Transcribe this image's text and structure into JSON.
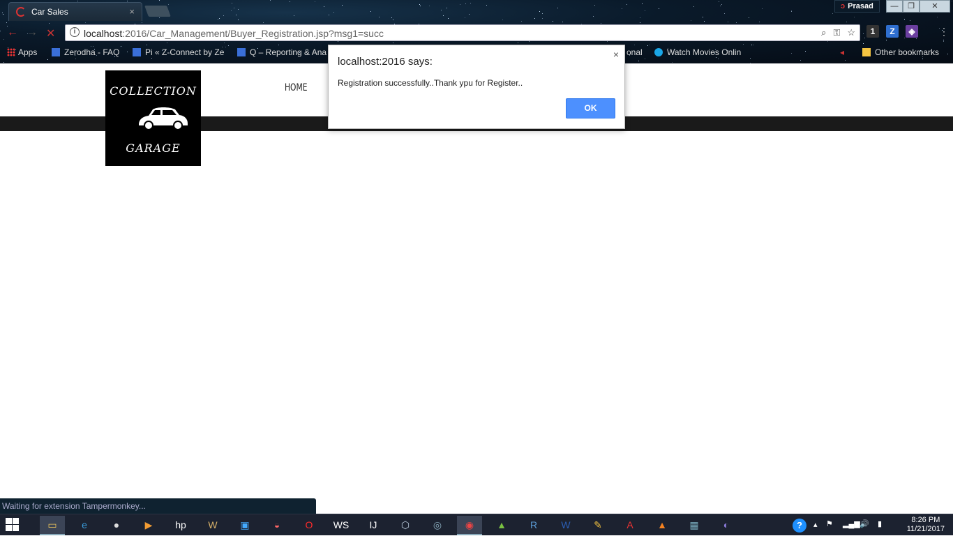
{
  "browser": {
    "tab_title": "Car Sales",
    "tab_close": "×",
    "profile_name": "Prasad",
    "window_controls": {
      "minimize": "—",
      "restore": "❐",
      "close": "✕"
    },
    "url_host": "localhost",
    "url_rest": ":2016/Car_Management/Buyer_Registration.jsp?msg1=succ",
    "info_icon": "i",
    "extensions": [
      {
        "name": "extension-badge-icon",
        "label": "1",
        "color": "#333333"
      },
      {
        "name": "zerodha-z-icon",
        "label": "Z",
        "color": "#2f6fd0"
      },
      {
        "name": "extension-purple-icon",
        "label": "◈",
        "color": "#6b3fa0"
      }
    ],
    "bookmarks": [
      {
        "label": "Apps"
      },
      {
        "label": "Zerodha - FAQ"
      },
      {
        "label": "Pi « Z-Connect by Ze"
      },
      {
        "label": "Q – Reporting & Ana"
      },
      {
        "label": "onal"
      },
      {
        "label": "Watch Movies Onlin"
      },
      {
        "label": "Other bookmarks"
      }
    ]
  },
  "page": {
    "logo_top": "COLLECTION",
    "logo_bottom": "GARAGE",
    "nav_home": "HOME"
  },
  "dialog": {
    "title": "localhost:2016 says:",
    "message": "Registration successfully..Thank ypu for Register..",
    "ok_label": "OK",
    "close": "×"
  },
  "status_bar": "Waiting for extension Tampermonkey...",
  "taskbar": {
    "time": "8:26 PM",
    "date": "11/21/2017",
    "help_icon": "?",
    "apps": [
      {
        "name": "file-explorer-icon",
        "glyph": "▭",
        "color": "#e8c25a"
      },
      {
        "name": "internet-explorer-icon",
        "glyph": "e",
        "color": "#3a9ad9"
      },
      {
        "name": "camera-app-icon",
        "glyph": "●",
        "color": "#dddddd"
      },
      {
        "name": "media-player-icon",
        "glyph": "▶",
        "color": "#f39c33"
      },
      {
        "name": "hp-icon",
        "glyph": "hp",
        "color": "#ffffff"
      },
      {
        "name": "word-doc-icon",
        "glyph": "W",
        "color": "#d8b26a"
      },
      {
        "name": "blue-app-icon",
        "glyph": "▣",
        "color": "#44aaff"
      },
      {
        "name": "flag-app-icon",
        "glyph": "◒",
        "color": "#ff6666"
      },
      {
        "name": "opera-icon",
        "glyph": "O",
        "color": "#ff2b2b"
      },
      {
        "name": "webstorm-icon",
        "glyph": "WS",
        "color": "#ffffff"
      },
      {
        "name": "intellij-icon",
        "glyph": "IJ",
        "color": "#ffffff"
      },
      {
        "name": "virtualbox-icon",
        "glyph": "⬡",
        "color": "#bcd"
      },
      {
        "name": "network-app-icon",
        "glyph": "◎",
        "color": "#8ab"
      },
      {
        "name": "chrome-icon",
        "glyph": "◉",
        "color": "#e44"
      },
      {
        "name": "android-icon",
        "glyph": "▲",
        "color": "#7ac142"
      },
      {
        "name": "r-icon",
        "glyph": "R",
        "color": "#5b9bd5"
      },
      {
        "name": "word-icon",
        "glyph": "W",
        "color": "#2b5eb4"
      },
      {
        "name": "paint-app-icon",
        "glyph": "✎",
        "color": "#f0c040"
      },
      {
        "name": "acrobat-icon",
        "glyph": "A",
        "color": "#e33"
      },
      {
        "name": "vlc-icon",
        "glyph": "▲",
        "color": "#f58220"
      },
      {
        "name": "image-viewer-icon",
        "glyph": "▦",
        "color": "#7ab"
      },
      {
        "name": "eclipse-icon",
        "glyph": "◐",
        "color": "#8a7ad8"
      }
    ]
  }
}
